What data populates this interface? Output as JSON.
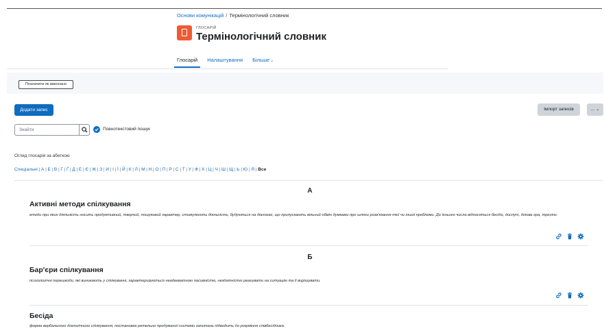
{
  "breadcrumb": {
    "course": "Основи комунікацій",
    "separator": "/",
    "current": "Термінологічний словник"
  },
  "header": {
    "module_type": "ГЛОСАРІЙ",
    "title": "Термінологічний словник"
  },
  "nav": {
    "glossary": "Глосарій",
    "settings": "Налаштування",
    "more": "Більше",
    "more_icon": "chevron-down-icon"
  },
  "activity": {
    "mark_done": "Позначити як виконано"
  },
  "toolbar": {
    "add_entry": "Додати запис",
    "import_entries": "Імпорт записів",
    "more_actions": "..."
  },
  "search": {
    "placeholder": "Знайти",
    "fulltext_label": "Повнотекстовий пошук",
    "fulltext_checked": true
  },
  "browse": {
    "label": "Огляд глосарія за абеткою",
    "special": "Спеціальні",
    "letters": [
      "А",
      "Б",
      "В",
      "Г",
      "Ґ",
      "Д",
      "Е",
      "Є",
      "Ж",
      "З",
      "И",
      "І",
      "Ї",
      "Й",
      "К",
      "Л",
      "М",
      "Н",
      "О",
      "П",
      "Р",
      "С",
      "Т",
      "У",
      "Ф",
      "Х",
      "Ц",
      "Ч",
      "Ш",
      "Щ",
      "Ь",
      "Ю",
      "Я"
    ],
    "all": "Все"
  },
  "entries": [
    {
      "group": "А",
      "title": "Активні методи спілкування",
      "definition": "етоди при яких діяльність носить продуктивний, творчий, пошуковий характер, стимулюють діяльність, будуються на діалогах, що припускають вільний обмін думками про шляхи розв'язання тієї чи іншої проблеми. До їхнього числа відносяться бесіди, диспут, ділова гра, тренінг."
    },
    {
      "group": "Б",
      "title": "Бар'єри спілкування",
      "definition": "психологічні перешкоди, які виникають у спілкуванні, характеризуються неадекватною пасивністю, нездатністю реагувати на ситуацію та її вирішувати."
    },
    {
      "group": "",
      "title": "Бесіда",
      "definition": "форма вербального діалогічного спілкування, постановка ретельно продуманої системи запитань підводить до розуміння співбесідника."
    }
  ],
  "actions": {
    "link_icon": "link-icon",
    "delete_icon": "trash-icon",
    "settings_icon": "gear-icon"
  },
  "colors": {
    "primary": "#0f6cbf",
    "module_icon": "#f05a33",
    "secondary_button": "#ced4da"
  }
}
